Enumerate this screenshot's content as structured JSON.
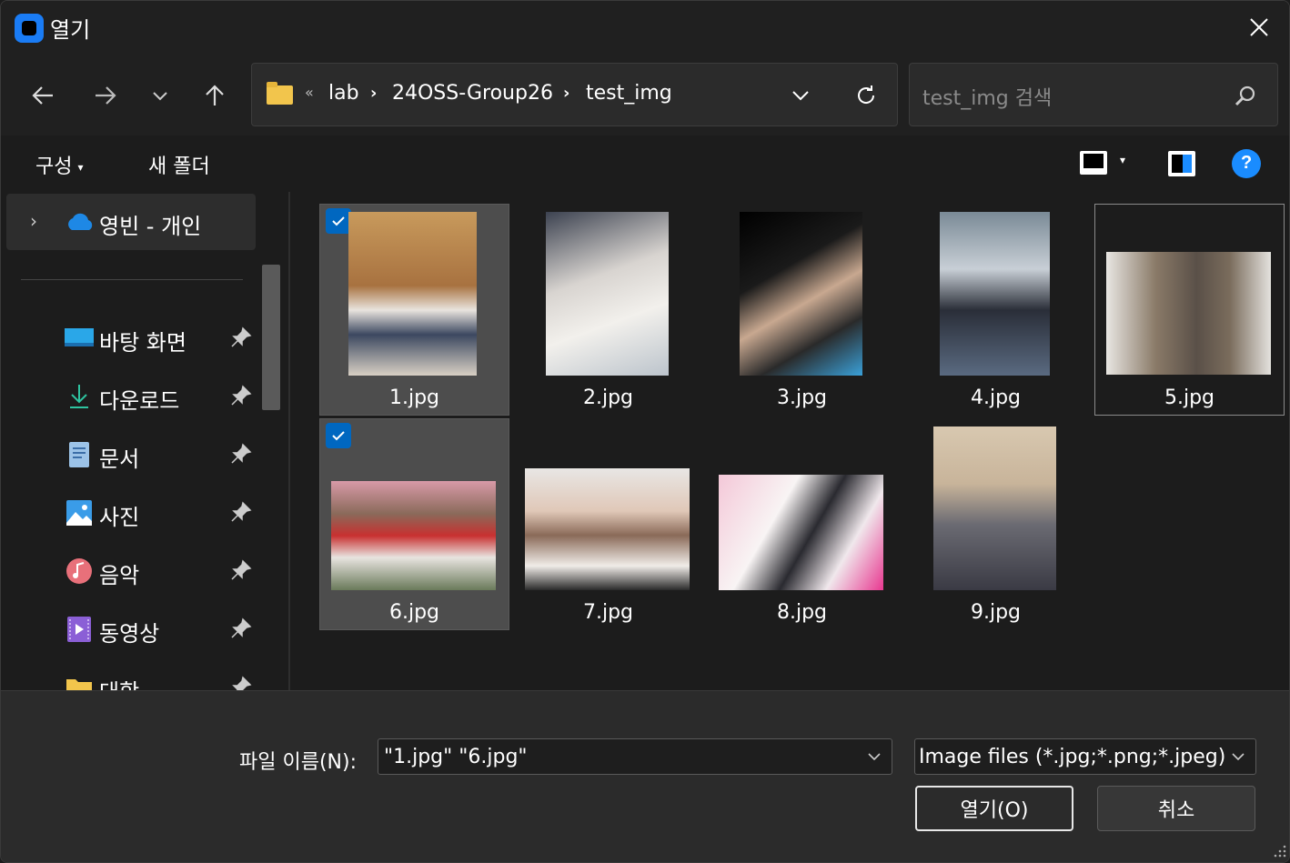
{
  "window": {
    "title": "열기"
  },
  "address": {
    "overflow": "«",
    "breadcrumbs": [
      "lab",
      "24OSS-Group26",
      "test_img"
    ],
    "separator": "›"
  },
  "search": {
    "placeholder": "test_img 검색"
  },
  "commandbar": {
    "organize": "구성",
    "new_folder": "새 폴더",
    "help": "?"
  },
  "sidebar": {
    "onedrive_label": "영빈 - 개인",
    "quick_access": [
      {
        "label": "바탕 화면",
        "icon": "desktop-icon"
      },
      {
        "label": "다운로드",
        "icon": "download-icon"
      },
      {
        "label": "문서",
        "icon": "documents-icon"
      },
      {
        "label": "사진",
        "icon": "pictures-icon"
      },
      {
        "label": "음악",
        "icon": "music-icon"
      },
      {
        "label": "동영상",
        "icon": "videos-icon"
      },
      {
        "label": "대학",
        "icon": "folder-icon"
      }
    ]
  },
  "files": [
    {
      "name": "1.jpg",
      "selected": true
    },
    {
      "name": "2.jpg",
      "selected": false
    },
    {
      "name": "3.jpg",
      "selected": false
    },
    {
      "name": "4.jpg",
      "selected": false
    },
    {
      "name": "5.jpg",
      "selected": false,
      "focused": true
    },
    {
      "name": "6.jpg",
      "selected": true
    },
    {
      "name": "7.jpg",
      "selected": false
    },
    {
      "name": "8.jpg",
      "selected": false
    },
    {
      "name": "9.jpg",
      "selected": false
    }
  ],
  "footer": {
    "filename_label": "파일 이름(N):",
    "filename_value": "\"1.jpg\" \"6.jpg\"",
    "filetype_value": "Image files (*.jpg;*.png;*.jpeg)",
    "open_button": "열기(O)",
    "cancel_button": "취소"
  },
  "colors": {
    "accent": "#0067c0",
    "selected_tile": "#4d4d4d",
    "folder": "#f2c54c"
  }
}
